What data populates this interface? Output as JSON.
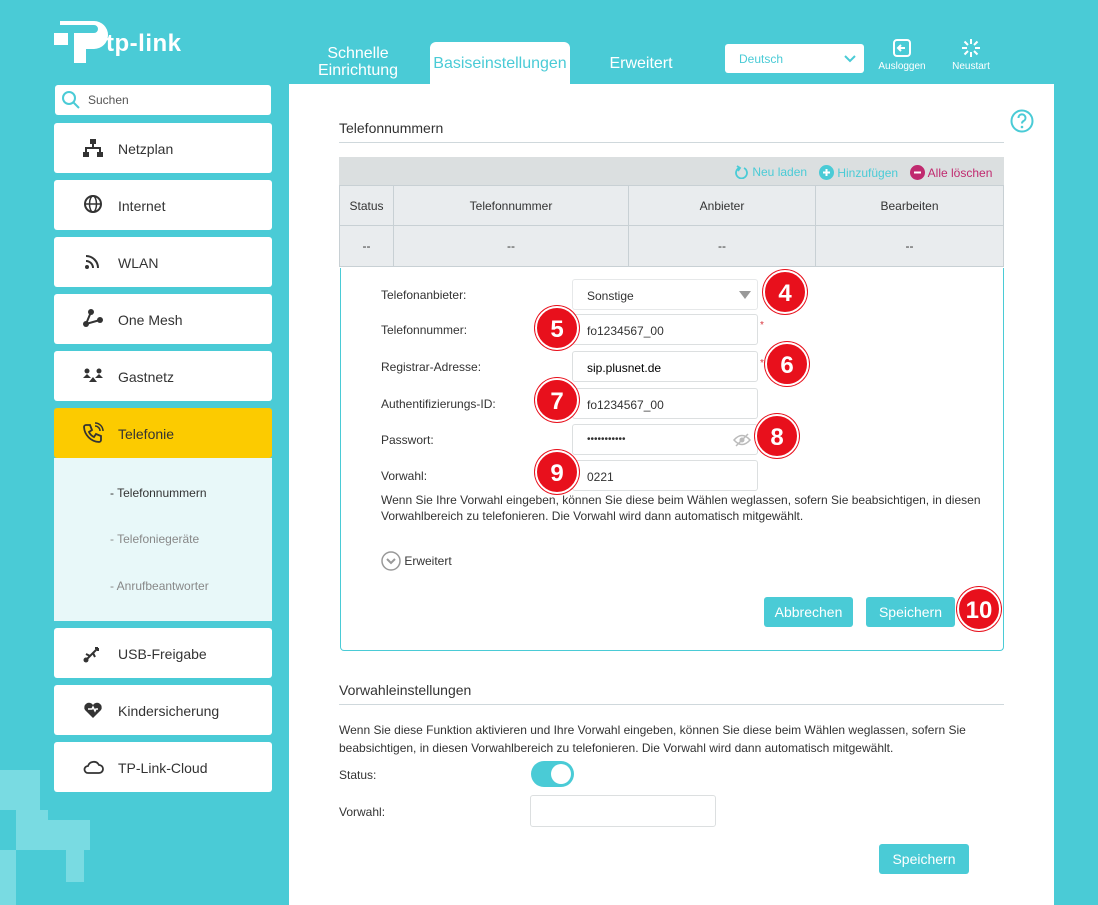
{
  "header": {
    "logo_text": "tp-link",
    "tabs": [
      {
        "line1": "Schnelle",
        "line2": "Einrichtung"
      },
      {
        "label": "Basiseinstellungen"
      },
      {
        "label": "Erweitert"
      }
    ],
    "language": "Deutsch",
    "logout_label": "Ausloggen",
    "restart_label": "Neustart"
  },
  "sidebar": {
    "search_placeholder": "Suchen",
    "items": [
      {
        "label": "Netzplan",
        "icon": "network-icon"
      },
      {
        "label": "Internet",
        "icon": "globe-icon"
      },
      {
        "label": "WLAN",
        "icon": "wifi-icon"
      },
      {
        "label": "One Mesh",
        "icon": "mesh-icon"
      },
      {
        "label": "Gastnetz",
        "icon": "guests-icon"
      },
      {
        "label": "Telefonie",
        "icon": "phone-icon"
      },
      {
        "label": "USB-Freigabe",
        "icon": "usb-icon"
      },
      {
        "label": "Kindersicherung",
        "icon": "heart-icon"
      },
      {
        "label": "TP-Link-Cloud",
        "icon": "cloud-icon"
      }
    ],
    "submenu": [
      "- Telefonnummern",
      "- Telefoniegeräte",
      "- Anrufbeantworter"
    ]
  },
  "phone_numbers": {
    "title": "Telefonnummern",
    "actions": {
      "reload": "Neu laden",
      "add": "Hinzufügen",
      "delete_all": "Alle löschen"
    },
    "columns": [
      "Status",
      "Telefonnummer",
      "Anbieter",
      "Bearbeiten"
    ],
    "row": [
      "--",
      "--",
      "--",
      "--"
    ],
    "form": {
      "provider_label": "Telefonanbieter:",
      "provider_value": "Sonstige",
      "number_label": "Telefonnummer:",
      "number_value": "fo1234567_00",
      "registrar_label": "Registrar-Adresse:",
      "registrar_value": "sip.plusnet.de",
      "auth_label": "Authentifizierungs-ID:",
      "auth_value": "fo1234567_00",
      "password_label": "Passwort:",
      "password_value": "•••••••••••",
      "prefix_label": "Vorwahl:",
      "prefix_value": "0221",
      "note": "Wenn Sie Ihre Vorwahl eingeben, können Sie diese beim Wählen weglassen, sofern Sie beabsichtigen, in diesen Vorwahlbereich zu telefonieren. Die Vorwahl wird dann automatisch mitgewählt.",
      "advanced_label": "Erweitert",
      "cancel_label": "Abbrechen",
      "save_label": "Speichern",
      "required_mark": "*"
    },
    "badges": [
      "4",
      "5",
      "6",
      "7",
      "8",
      "9",
      "10"
    ]
  },
  "prefix_settings": {
    "title": "Vorwahleinstellungen",
    "note": "Wenn Sie diese Funktion aktivieren und Ihre Vorwahl eingeben, können Sie diese beim Wählen weglassen, sofern Sie beabsichtigen, in diesen Vorwahlbereich zu telefonieren. Die Vorwahl wird dann automatisch mitgewählt.",
    "status_label": "Status:",
    "status_on": true,
    "prefix_label": "Vorwahl:",
    "prefix_value": "",
    "save_label": "Speichern"
  },
  "colors": {
    "accent": "#4acbd6",
    "active_nav": "#fccb00",
    "badge": "#e8101c",
    "delete": "#c02a6f"
  }
}
